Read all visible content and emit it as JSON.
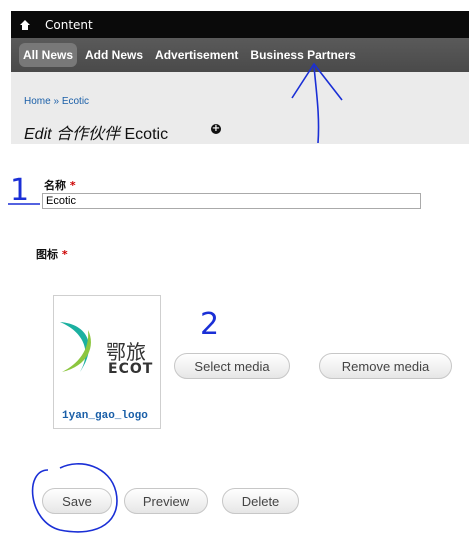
{
  "toolbar": {
    "content_label": "Content"
  },
  "tabs": [
    {
      "label": "All News"
    },
    {
      "label": "Add News"
    },
    {
      "label": "Advertisement"
    },
    {
      "label": "Business Partners"
    }
  ],
  "breadcrumb": {
    "home": "Home",
    "sep": " » ",
    "current": "Ecotic"
  },
  "page_title": {
    "edit": "Edit",
    "type": "合作伙伴",
    "name": "Ecotic"
  },
  "form": {
    "name_label": "名称",
    "name_value": "Ecotic",
    "icon_label": "图标",
    "required_mark": "*"
  },
  "media": {
    "logo_text_cn": "鄂旅",
    "logo_text_en": "ECOT",
    "filename": "1yan_gao_logo",
    "select_label": "Select media",
    "remove_label": "Remove media"
  },
  "actions": {
    "save": "Save",
    "preview": "Preview",
    "delete": "Delete"
  },
  "annotations": {
    "mark1": "1",
    "mark2": "2"
  },
  "colors": {
    "link": "#1a5fa8",
    "annotation": "#1a2fd6",
    "required": "#cc0000"
  }
}
